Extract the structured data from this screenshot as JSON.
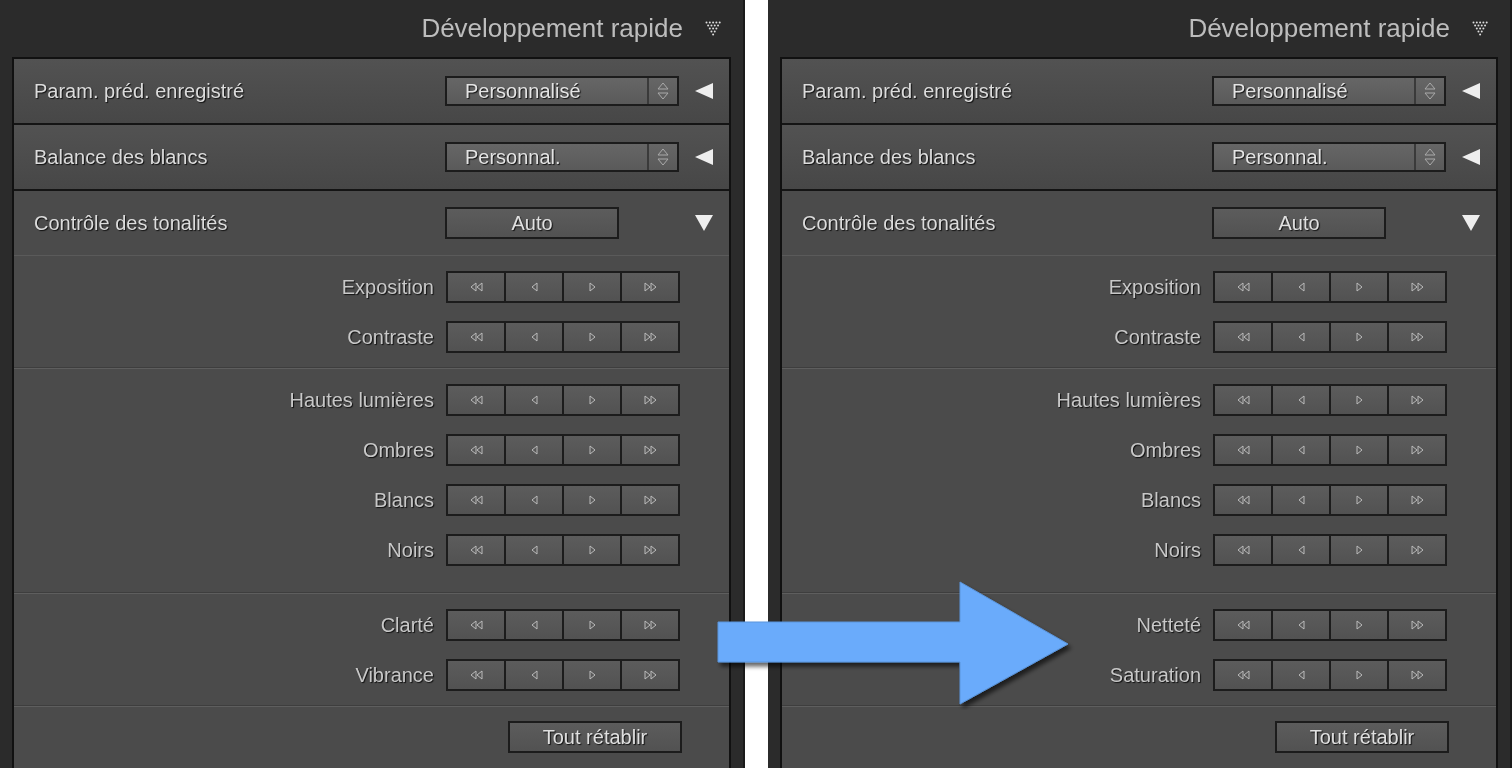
{
  "panels": [
    {
      "title": "Développement rapide",
      "sections": [
        {
          "kind": "dropdown",
          "label": "Param. préd. enregistré",
          "value": "Personnalisé",
          "expanded": false
        },
        {
          "kind": "dropdown",
          "label": "Balance des blancs",
          "value": "Personnal.",
          "expanded": false
        },
        {
          "kind": "tone",
          "label": "Contrôle des tonalités",
          "button": "Auto",
          "expanded": true,
          "groups": [
            [
              {
                "label": "Exposition"
              },
              {
                "label": "Contraste"
              }
            ],
            [
              {
                "label": "Hautes lumières"
              },
              {
                "label": "Ombres"
              },
              {
                "label": "Blancs"
              },
              {
                "label": "Noirs"
              }
            ],
            [
              {
                "label": "Clarté"
              },
              {
                "label": "Vibrance"
              }
            ]
          ],
          "reset": "Tout rétablir"
        }
      ]
    },
    {
      "title": "Développement rapide",
      "sections": [
        {
          "kind": "dropdown",
          "label": "Param. préd. enregistré",
          "value": "Personnalisé",
          "expanded": false
        },
        {
          "kind": "dropdown",
          "label": "Balance des blancs",
          "value": "Personnal.",
          "expanded": false
        },
        {
          "kind": "tone",
          "label": "Contrôle des tonalités",
          "button": "Auto",
          "expanded": true,
          "groups": [
            [
              {
                "label": "Exposition"
              },
              {
                "label": "Contraste"
              }
            ],
            [
              {
                "label": "Hautes lumières"
              },
              {
                "label": "Ombres"
              },
              {
                "label": "Blancs"
              },
              {
                "label": "Noirs"
              }
            ],
            [
              {
                "label": "Netteté"
              },
              {
                "label": "Saturation"
              }
            ]
          ],
          "reset": "Tout rétablir"
        }
      ]
    }
  ]
}
